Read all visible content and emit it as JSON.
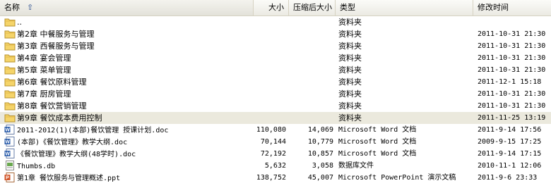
{
  "columns": {
    "name": "名称",
    "size": "大小",
    "compressed_size": "压缩后大小",
    "type": "类型",
    "modified": "修改时间"
  },
  "rows": [
    {
      "icon": "folder-icon",
      "name": "..",
      "size": "",
      "compressed_size": "",
      "type": "资料夹",
      "modified": ""
    },
    {
      "icon": "folder-icon",
      "name": "第2章 中餐服务与管理",
      "size": "",
      "compressed_size": "",
      "type": "资料夹",
      "modified": "2011-10-31 21:30"
    },
    {
      "icon": "folder-icon",
      "name": "第3章 西餐服务与管理",
      "size": "",
      "compressed_size": "",
      "type": "资料夹",
      "modified": "2011-10-31 21:30"
    },
    {
      "icon": "folder-icon",
      "name": "第4章 宴会管理",
      "size": "",
      "compressed_size": "",
      "type": "资料夹",
      "modified": "2011-10-31 21:30"
    },
    {
      "icon": "folder-icon",
      "name": "第5章 菜单管理",
      "size": "",
      "compressed_size": "",
      "type": "资料夹",
      "modified": "2011-10-31 21:30"
    },
    {
      "icon": "folder-icon",
      "name": "第6章 餐饮原料管理",
      "size": "",
      "compressed_size": "",
      "type": "资料夹",
      "modified": "2011-12-1 15:18"
    },
    {
      "icon": "folder-icon",
      "name": "第7章 厨房管理",
      "size": "",
      "compressed_size": "",
      "type": "资料夹",
      "modified": "2011-10-31 21:30"
    },
    {
      "icon": "folder-icon",
      "name": "第8章 餐饮营销管理",
      "size": "",
      "compressed_size": "",
      "type": "资料夹",
      "modified": "2011-10-31 21:30"
    },
    {
      "icon": "folder-icon",
      "name": "第9章 餐饮成本费用控制",
      "size": "",
      "compressed_size": "",
      "type": "资料夹",
      "modified": "2011-11-25 13:19",
      "selected": true
    },
    {
      "icon": "word-doc-icon",
      "name": "2011-2012(1)(本部)餐饮管理  授课计划.doc",
      "size": "110,080",
      "compressed_size": "14,069",
      "type": "Microsoft Word 文档",
      "modified": "2011-9-14 17:56"
    },
    {
      "icon": "word-doc-icon",
      "name": "(本部)《餐饮管理》教学大纲.doc",
      "size": "70,144",
      "compressed_size": "10,779",
      "type": "Microsoft Word 文档",
      "modified": "2009-9-15 17:25"
    },
    {
      "icon": "word-doc-icon",
      "name": "《餐饮管理》教学大纲(48学时).doc",
      "size": "72,192",
      "compressed_size": "10,857",
      "type": "Microsoft Word 文档",
      "modified": "2011-9-14 17:15"
    },
    {
      "icon": "db-file-icon",
      "name": "Thumbs.db",
      "size": "5,632",
      "compressed_size": "3,058",
      "type": "数据库文件",
      "modified": "2010-11-1 12:06"
    },
    {
      "icon": "ppt-file-icon",
      "name": "第1章 餐饮服务与管理概述.ppt",
      "size": "138,752",
      "compressed_size": "45,007",
      "type": "Microsoft PowerPoint 演示文稿",
      "modified": "2011-9-6 23:33"
    }
  ]
}
